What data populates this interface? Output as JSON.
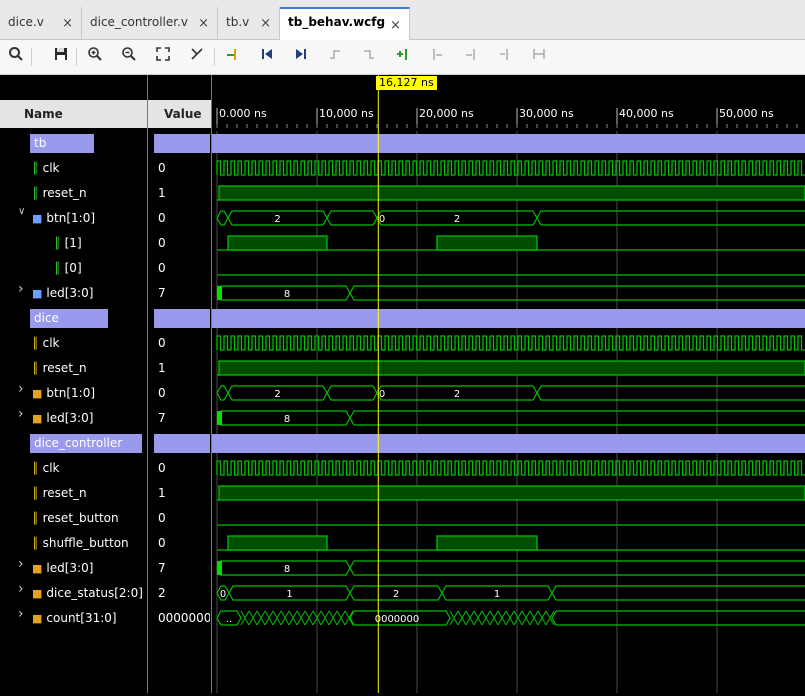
{
  "tabs": [
    {
      "label": "dice.v",
      "close": "×"
    },
    {
      "label": "dice_controller.v",
      "close": "×"
    },
    {
      "label": "tb.v",
      "close": "×"
    },
    {
      "label": "tb_behav.wcfg",
      "close": "×"
    }
  ],
  "toolbar": {
    "icons": [
      "search-icon",
      "save-icon",
      "zoom-in-icon",
      "zoom-out-icon",
      "zoom-fit-icon",
      "swap-cursor-icon",
      "go-to-cursor-icon",
      "go-to-time-0-icon",
      "go-to-last-time-icon",
      "previous-transition-icon",
      "next-transition-icon",
      "add-marker-icon",
      "previous-marker-icon",
      "next-marker-icon",
      "delete-marker-icon",
      "snap-icon"
    ]
  },
  "headers": {
    "name": "Name",
    "value": "Value"
  },
  "cursor": {
    "label": "16,127 ns",
    "color": "#ffff00"
  },
  "time_axis": {
    "ticks": [
      "0.000 ns",
      "10,000 ns",
      "20,000 ns",
      "30,000 ns",
      "40,000 ns",
      "50,000 ns"
    ]
  },
  "colors": {
    "group_bar": "#9999ee",
    "wave_green": "#00c000",
    "bus_fill": "#004d00"
  },
  "signals": [
    {
      "name": "tb",
      "value": "",
      "type": "group"
    },
    {
      "name": "clk",
      "value": "0",
      "type": "bit"
    },
    {
      "name": "reset_n",
      "value": "1",
      "type": "bit"
    },
    {
      "name": "btn[1:0]",
      "value": "0",
      "type": "bus",
      "expanded": true
    },
    {
      "name": "[1]",
      "value": "0",
      "type": "bit",
      "indent": true
    },
    {
      "name": "[0]",
      "value": "0",
      "type": "bit",
      "indent": true
    },
    {
      "name": "led[3:0]",
      "value": "7",
      "type": "bus"
    },
    {
      "name": "dice",
      "value": "",
      "type": "group"
    },
    {
      "name": "clk",
      "value": "0",
      "type": "bit"
    },
    {
      "name": "reset_n",
      "value": "1",
      "type": "bit"
    },
    {
      "name": "btn[1:0]",
      "value": "0",
      "type": "bus"
    },
    {
      "name": "led[3:0]",
      "value": "7",
      "type": "bus"
    },
    {
      "name": "dice_controller",
      "value": "",
      "type": "group"
    },
    {
      "name": "clk",
      "value": "0",
      "type": "bit"
    },
    {
      "name": "reset_n",
      "value": "1",
      "type": "bit"
    },
    {
      "name": "reset_button",
      "value": "0",
      "type": "bit"
    },
    {
      "name": "shuffle_button",
      "value": "0",
      "type": "bit"
    },
    {
      "name": "led[3:0]",
      "value": "7",
      "type": "bus"
    },
    {
      "name": "dice_status[2:0]",
      "value": "2",
      "type": "bus"
    },
    {
      "name": "count[31:0]",
      "value": "0000000",
      "type": "bus"
    }
  ],
  "bus_labels": {
    "btn_a": "2",
    "btn_b": "0",
    "btn_c": "2",
    "led": "8",
    "status_a": "0",
    "status_b": "1",
    "status_c": "2",
    "status_d": "1",
    "count_a": "..",
    "count_b": "0000000"
  }
}
